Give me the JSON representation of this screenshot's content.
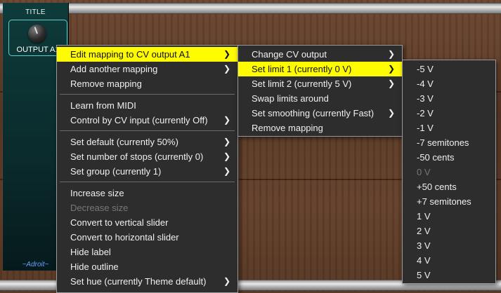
{
  "module": {
    "title": "TITLE",
    "knob_label": "OUTPUT A1",
    "footer": "~Adroit~"
  },
  "context_menu": {
    "items": [
      {
        "label": "Edit mapping to CV output A1",
        "submenu": true,
        "highlighted": true
      },
      {
        "label": "Add another mapping",
        "submenu": true
      },
      {
        "label": "Remove mapping"
      },
      {
        "label": "Learn from MIDI"
      },
      {
        "label": "Control by CV input (currently Off)",
        "submenu": true
      },
      {
        "label": "Set default (currently 50%)",
        "submenu": true
      },
      {
        "label": "Set number of stops (currently 0)",
        "submenu": true
      },
      {
        "label": "Set group (currently 1)",
        "submenu": true
      },
      {
        "label": "Increase size"
      },
      {
        "label": "Decrease size",
        "disabled": true
      },
      {
        "label": "Convert to vertical slider"
      },
      {
        "label": "Convert to horizontal slider"
      },
      {
        "label": "Hide label"
      },
      {
        "label": "Hide outline"
      },
      {
        "label": "Set hue (currently Theme default)",
        "submenu": true
      }
    ]
  },
  "mapping_menu": {
    "items": [
      {
        "label": "Change CV output",
        "submenu": true
      },
      {
        "label": "Set limit 1 (currently 0 V)",
        "submenu": true,
        "highlighted": true
      },
      {
        "label": "Set limit 2 (currently 5 V)",
        "submenu": true
      },
      {
        "label": "Swap limits around"
      },
      {
        "label": "Set smoothing (currently Fast)",
        "submenu": true
      },
      {
        "label": "Remove mapping"
      }
    ]
  },
  "limit_menu": {
    "items": [
      {
        "label": "-5 V"
      },
      {
        "label": "-4 V"
      },
      {
        "label": "-3 V"
      },
      {
        "label": "-2 V"
      },
      {
        "label": "-1 V"
      },
      {
        "label": "-7 semitones"
      },
      {
        "label": "-50 cents"
      },
      {
        "label": "0 V",
        "disabled": true
      },
      {
        "label": "+50 cents"
      },
      {
        "label": "+7 semitones"
      },
      {
        "label": "1 V"
      },
      {
        "label": "2 V"
      },
      {
        "label": "3 V"
      },
      {
        "label": "4 V"
      },
      {
        "label": "5 V"
      }
    ]
  },
  "icons": {
    "submenu_arrow": "chevron-right-icon",
    "arrow_glyph": "❯"
  },
  "colors": {
    "highlight": "#fffb00",
    "menu_bg": "#2d2d2d",
    "menu_text": "#f0f0f0",
    "disabled_text": "#777777",
    "module_accent": "#5ad2c8",
    "footer_text": "#6aa0ff"
  }
}
